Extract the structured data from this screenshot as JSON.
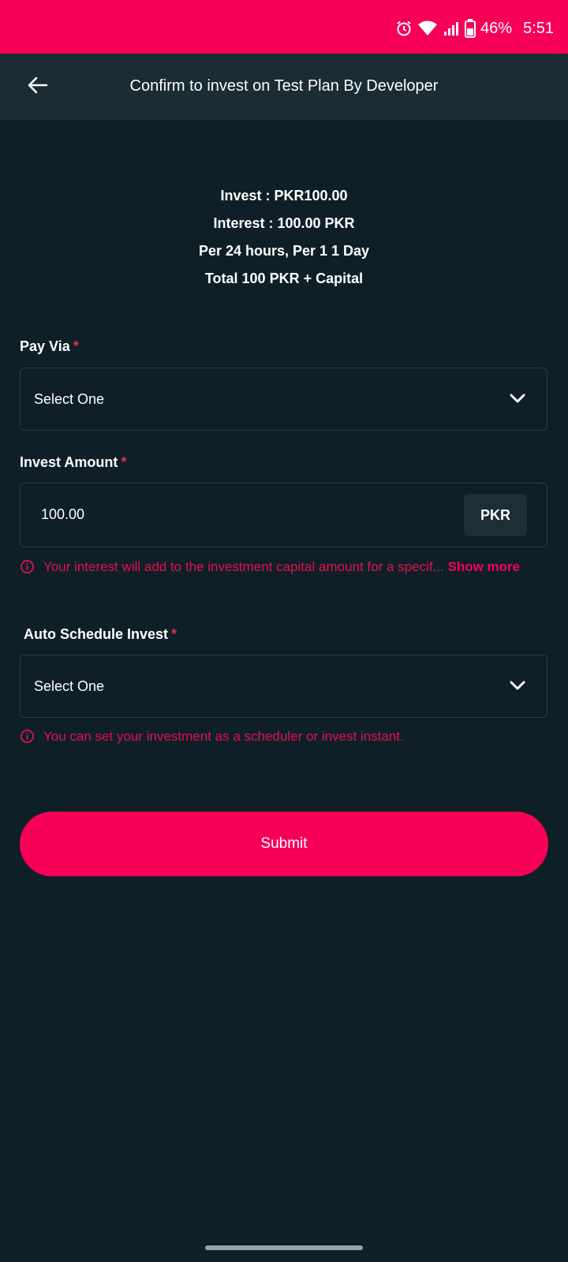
{
  "status_bar": {
    "battery": "46%",
    "time": "5:51"
  },
  "app_bar": {
    "title": "Confirm to invest on Test Plan By Developer"
  },
  "summary": {
    "invest": "Invest : PKR100.00",
    "interest": "Interest : 100.00 PKR",
    "period": "Per 24 hours,  Per 1 1 Day",
    "total": "Total 100 PKR + Capital"
  },
  "pay_via": {
    "label": "Pay Via",
    "required": "*",
    "value": "Select One"
  },
  "invest_amount": {
    "label": "Invest Amount",
    "required": "*",
    "value": "100.00",
    "currency": "PKR",
    "hint": "Your interest will add to the investment capital amount for a specif...",
    "hint_more": "Show more"
  },
  "auto_schedule": {
    "label": "Auto Schedule Invest",
    "required": "*",
    "value": "Select One",
    "hint": "You can set your investment as a scheduler or invest instant."
  },
  "submit": {
    "label": "Submit"
  },
  "colors": {
    "accent": "#f70158",
    "background": "#0f1f28",
    "app_bar": "#1a2c34",
    "hint": "#e0124f"
  }
}
